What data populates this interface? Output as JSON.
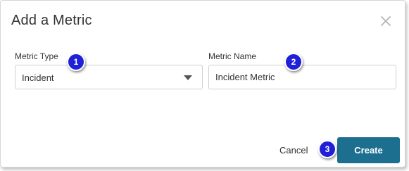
{
  "dialog": {
    "title": "Add a Metric",
    "close_icon": "close-icon"
  },
  "form": {
    "metric_type": {
      "label": "Metric Type",
      "value": "Incident",
      "icon": "chevron-down-icon"
    },
    "metric_name": {
      "label": "Metric Name",
      "value": "Incident Metric"
    }
  },
  "actions": {
    "cancel_label": "Cancel",
    "create_label": "Create"
  },
  "callouts": [
    "1",
    "2",
    "3"
  ],
  "colors": {
    "primary": "#1d6f8f",
    "callout": "#2020d8"
  }
}
